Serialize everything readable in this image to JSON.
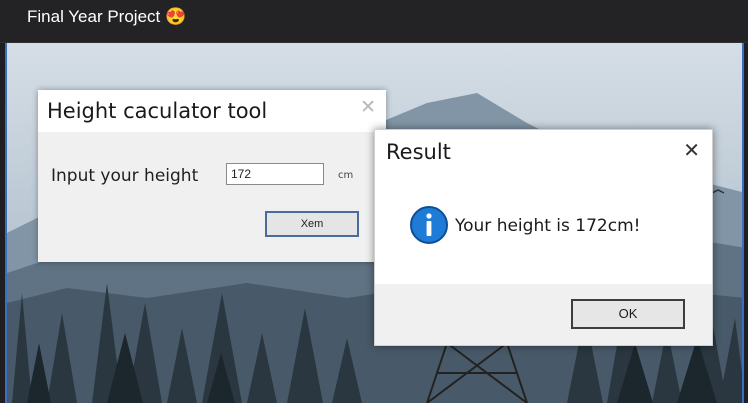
{
  "post": {
    "title": "Final Year Project 😍"
  },
  "height_tool": {
    "title": "Height caculator tool",
    "close_glyph": "✕",
    "label": "Input your height",
    "input_value": "172",
    "unit": "cm",
    "button_label": "Xem"
  },
  "result": {
    "title": "Result",
    "close_glyph": "✕",
    "info_icon": "information-icon",
    "message": "Your height is 172cm!",
    "ok_label": "OK"
  },
  "colors": {
    "header_bg": "#232326",
    "info_blue": "#1e7bd8",
    "sky": "#b9c8d5"
  }
}
